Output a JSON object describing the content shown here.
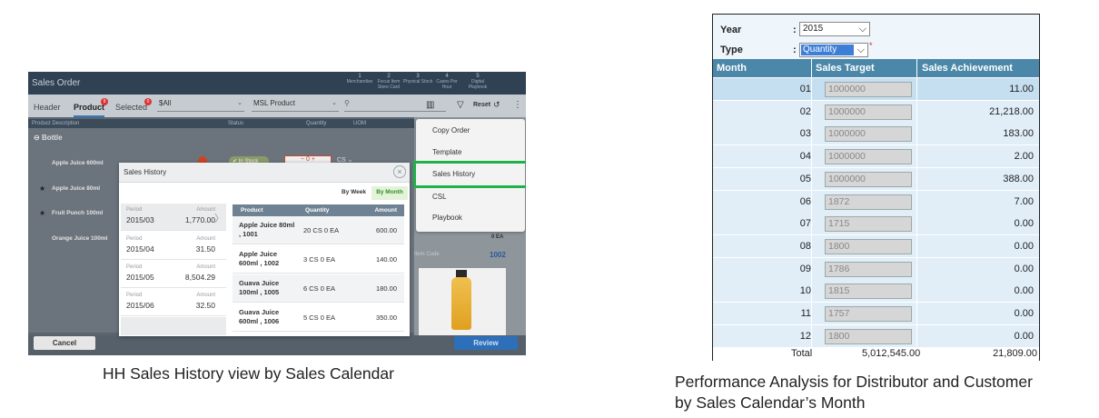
{
  "tablet": {
    "title": "Sales Order",
    "steps": [
      {
        "num": "1",
        "label": "Merchandise"
      },
      {
        "num": "2",
        "label": "Focus Item Store Card"
      },
      {
        "num": "3",
        "label": "Physical Stock"
      },
      {
        "num": "4",
        "label": "Cases Per Hour"
      },
      {
        "num": "5",
        "label": "Digital Playbook"
      }
    ],
    "tabs": {
      "header": "Header",
      "product": "Product",
      "product_badge": "9",
      "selected": "Selected",
      "selected_badge": "0"
    },
    "filter_all": "$All",
    "filter_msl": "MSL Product",
    "reset_label": "Reset",
    "columns": {
      "description": "Product Description",
      "status": "Status",
      "quantity": "Quantity",
      "uom": "UOM"
    },
    "group_label": "Bottle",
    "products": [
      "Apple Juice 600ml",
      "Apple Juice 80ml",
      "Fruit Punch 100ml",
      "Orange Juice 100ml"
    ],
    "in_stock": "In Stock",
    "qty_value": "0",
    "uom_value": "CS",
    "item_code_label": "Item Code",
    "item_code_value": "1002",
    "ea_label": "0 EA",
    "cancel_label": "Cancel",
    "review_label": "Review",
    "context_menu": [
      "Copy Order",
      "Template",
      "Sales History",
      "CSL",
      "Playbook"
    ]
  },
  "dialog": {
    "title": "Sales History",
    "by_week": "By Week",
    "by_month": "By Month",
    "period_label": "Period",
    "amount_label": "Amount",
    "periods": [
      {
        "period": "2015/03",
        "amount": "1,770.00"
      },
      {
        "period": "2015/04",
        "amount": "31.50"
      },
      {
        "period": "2015/05",
        "amount": "8,504.29"
      },
      {
        "period": "2015/06",
        "amount": "32.50"
      }
    ],
    "table_headers": {
      "product": "Product",
      "quantity": "Quantity",
      "amount": "Amount"
    },
    "rows": [
      {
        "product": "Apple Juice 80ml , 1001",
        "quantity": "20 CS 0 EA",
        "amount": "600.00"
      },
      {
        "product": "Apple Juice 600ml , 1002",
        "quantity": "3 CS 0 EA",
        "amount": "140.00"
      },
      {
        "product": "Guava Juice 100ml , 1005",
        "quantity": "6 CS 0 EA",
        "amount": "180.00"
      },
      {
        "product": "Guava Juice 600ml , 1006",
        "quantity": "5 CS 0 EA",
        "amount": "350.00"
      }
    ]
  },
  "left_caption": "HH Sales History view by Sales Calendar",
  "report": {
    "year_label": "Year",
    "year_value": "2015",
    "type_label": "Type",
    "type_value": "Quantity",
    "required_mark": "*",
    "colon": ":",
    "headers": {
      "month": "Month",
      "target": "Sales Target",
      "achievement": "Sales Achievement"
    },
    "rows": [
      {
        "month": "01",
        "target": "1000000",
        "achievement": "11.00"
      },
      {
        "month": "02",
        "target": "1000000",
        "achievement": "21,218.00"
      },
      {
        "month": "03",
        "target": "1000000",
        "achievement": "183.00"
      },
      {
        "month": "04",
        "target": "1000000",
        "achievement": "2.00"
      },
      {
        "month": "05",
        "target": "1000000",
        "achievement": "388.00"
      },
      {
        "month": "06",
        "target": "1872",
        "achievement": "7.00"
      },
      {
        "month": "07",
        "target": "1715",
        "achievement": "0.00"
      },
      {
        "month": "08",
        "target": "1800",
        "achievement": "0.00"
      },
      {
        "month": "09",
        "target": "1786",
        "achievement": "0.00"
      },
      {
        "month": "10",
        "target": "1815",
        "achievement": "0.00"
      },
      {
        "month": "11",
        "target": "1757",
        "achievement": "0.00"
      },
      {
        "month": "12",
        "target": "1800",
        "achievement": "0.00"
      }
    ],
    "total_label": "Total",
    "total_target": "5,012,545.00",
    "total_achievement": "21,809.00"
  },
  "right_caption_line1": "Performance Analysis for Distributor and Customer",
  "right_caption_line2": "by Sales Calendar’s Month",
  "colors": {
    "highlight": "#1fb14a",
    "header_blue": "#4b87a8",
    "dropdown_selected": "#3d7fd6"
  }
}
